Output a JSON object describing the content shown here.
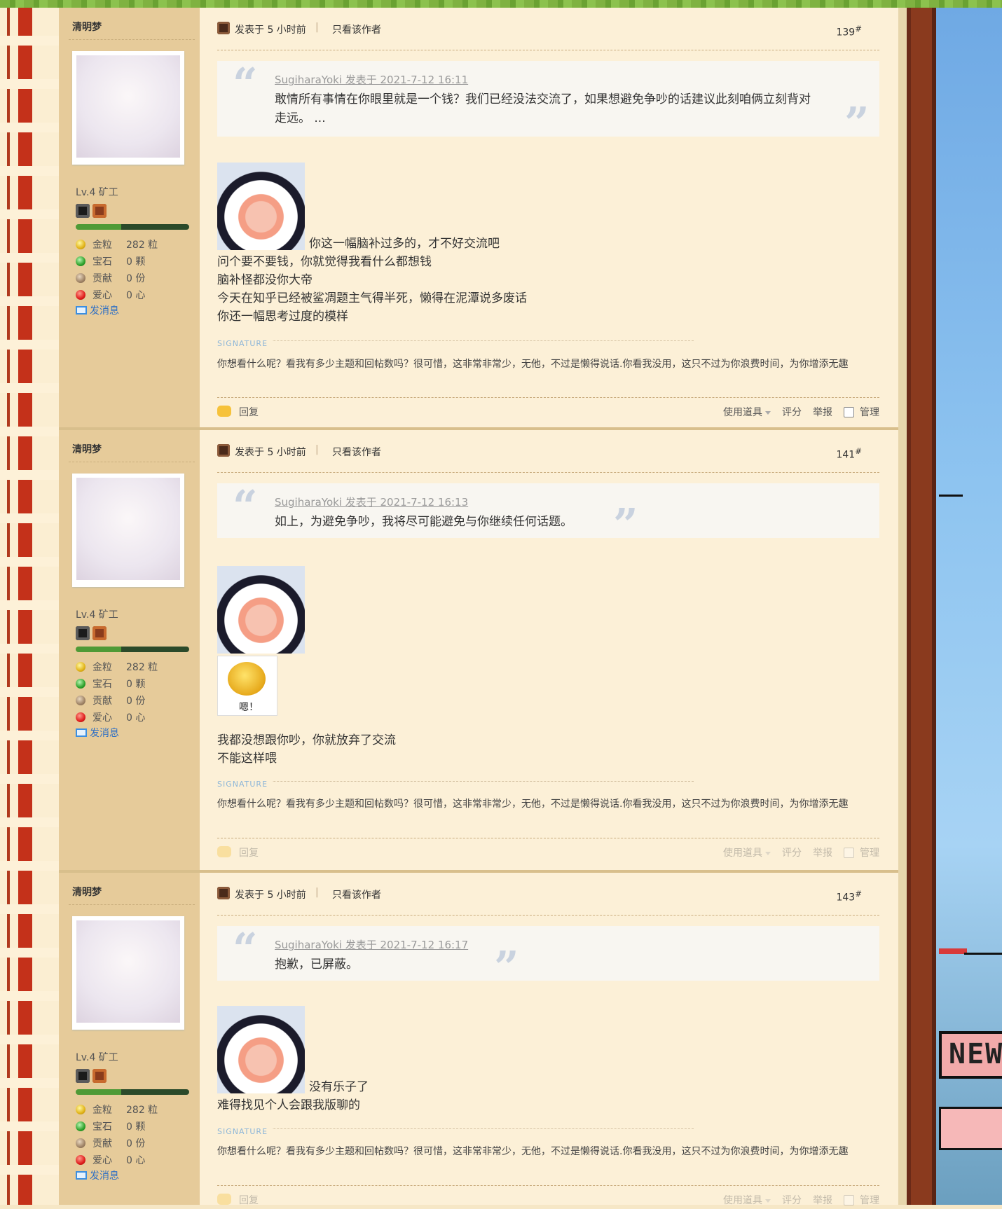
{
  "posts": [
    {
      "author": "清明梦",
      "level": "Lv.4 矿工",
      "stats": [
        {
          "icon": "gold-icon",
          "label": "金粒",
          "value": "282 粒"
        },
        {
          "icon": "gem-icon",
          "label": "宝石",
          "value": "0 颗"
        },
        {
          "icon": "contribution-icon",
          "label": "贡献",
          "value": "0 份"
        },
        {
          "icon": "heart-apple-icon",
          "label": "爱心",
          "value": "0 心"
        }
      ],
      "send_message": "发消息",
      "posted": "发表于 5 小时前",
      "only_author": "只看该作者",
      "floor": "139",
      "floor_mark": "#",
      "quote_head": "SugiharaYoki 发表于 2021-7-12 16:11",
      "quote_text": "敢情所有事情在你眼里就是一个钱？我们已经没法交流了，如果想避免争吵的话建议此刻咱俩立刻背对走远。 ...",
      "content_first": "你这一幅脑补过多的，才不好交流吧",
      "content_lines": [
        "问个要不要钱，你就觉得我看什么都想钱",
        "脑补怪都没你大帝",
        "今天在知乎已经被鲨凋题主气得半死，懒得在泥潭说多废话",
        "你还一幅思考过度的模样"
      ],
      "signature_label": "SIGNATURE",
      "signature": "你想看什么呢？看我有多少主题和回帖数吗？很可惜，这非常非常少，无他，不过是懒得说话.你看我没用，这只不过为你浪费时间，为你增添无趣",
      "actions": {
        "reply": "回复",
        "use_item": "使用道具",
        "rate": "评分",
        "report": "举报",
        "manage": "管理"
      }
    },
    {
      "author": "清明梦",
      "level": "Lv.4 矿工",
      "stats": [
        {
          "icon": "gold-icon",
          "label": "金粒",
          "value": "282 粒"
        },
        {
          "icon": "gem-icon",
          "label": "宝石",
          "value": "0 颗"
        },
        {
          "icon": "contribution-icon",
          "label": "贡献",
          "value": "0 份"
        },
        {
          "icon": "heart-apple-icon",
          "label": "爱心",
          "value": "0 心"
        }
      ],
      "send_message": "发消息",
      "posted": "发表于 5 小时前",
      "only_author": "只看该作者",
      "floor": "141",
      "floor_mark": "#",
      "quote_head": "SugiharaYoki 发表于 2021-7-12 16:13",
      "quote_text": "如上，为避免争吵，我将尽可能避免与你继续任何话题。",
      "sticker_caption": "嗯！",
      "content_lines": [
        "我都没想跟你吵，你就放弃了交流",
        "不能这样喂"
      ],
      "signature_label": "SIGNATURE",
      "signature": "你想看什么呢？看我有多少主题和回帖数吗？很可惜，这非常非常少，无他，不过是懒得说话.你看我没用，这只不过为你浪费时间，为你增添无趣",
      "actions": {
        "reply": "回复",
        "use_item": "使用道具",
        "rate": "评分",
        "report": "举报",
        "manage": "管理"
      }
    },
    {
      "author": "清明梦",
      "level": "Lv.4 矿工",
      "stats": [
        {
          "icon": "gold-icon",
          "label": "金粒",
          "value": "282 粒"
        },
        {
          "icon": "gem-icon",
          "label": "宝石",
          "value": "0 颗"
        },
        {
          "icon": "contribution-icon",
          "label": "贡献",
          "value": "0 份"
        },
        {
          "icon": "heart-apple-icon",
          "label": "爱心",
          "value": "0 心"
        }
      ],
      "send_message": "发消息",
      "posted": "发表于 5 小时前",
      "only_author": "只看该作者",
      "floor": "143",
      "floor_mark": "#",
      "quote_head": "SugiharaYoki 发表于 2021-7-12 16:17",
      "quote_text": "抱歉，已屏蔽。",
      "content_first": "没有乐子了",
      "content_lines": [
        "难得找见个人会跟我版聊的"
      ],
      "signature_label": "SIGNATURE",
      "signature": "你想看什么呢？看我有多少主题和回帖数吗？很可惜，这非常非常少，无他，不过是懒得说话.你看我没用，这只不过为你浪费时间，为你增添无趣",
      "actions": {
        "reply": "回复",
        "use_item": "使用道具",
        "rate": "评分",
        "report": "举报",
        "manage": "管理"
      }
    }
  ],
  "decor": {
    "new_sign": "NEW"
  },
  "colors": {
    "sidebar": "#e6cb9a",
    "main": "#fcf0d7",
    "link": "#2e6fc4",
    "signature": "#8db6d8"
  }
}
